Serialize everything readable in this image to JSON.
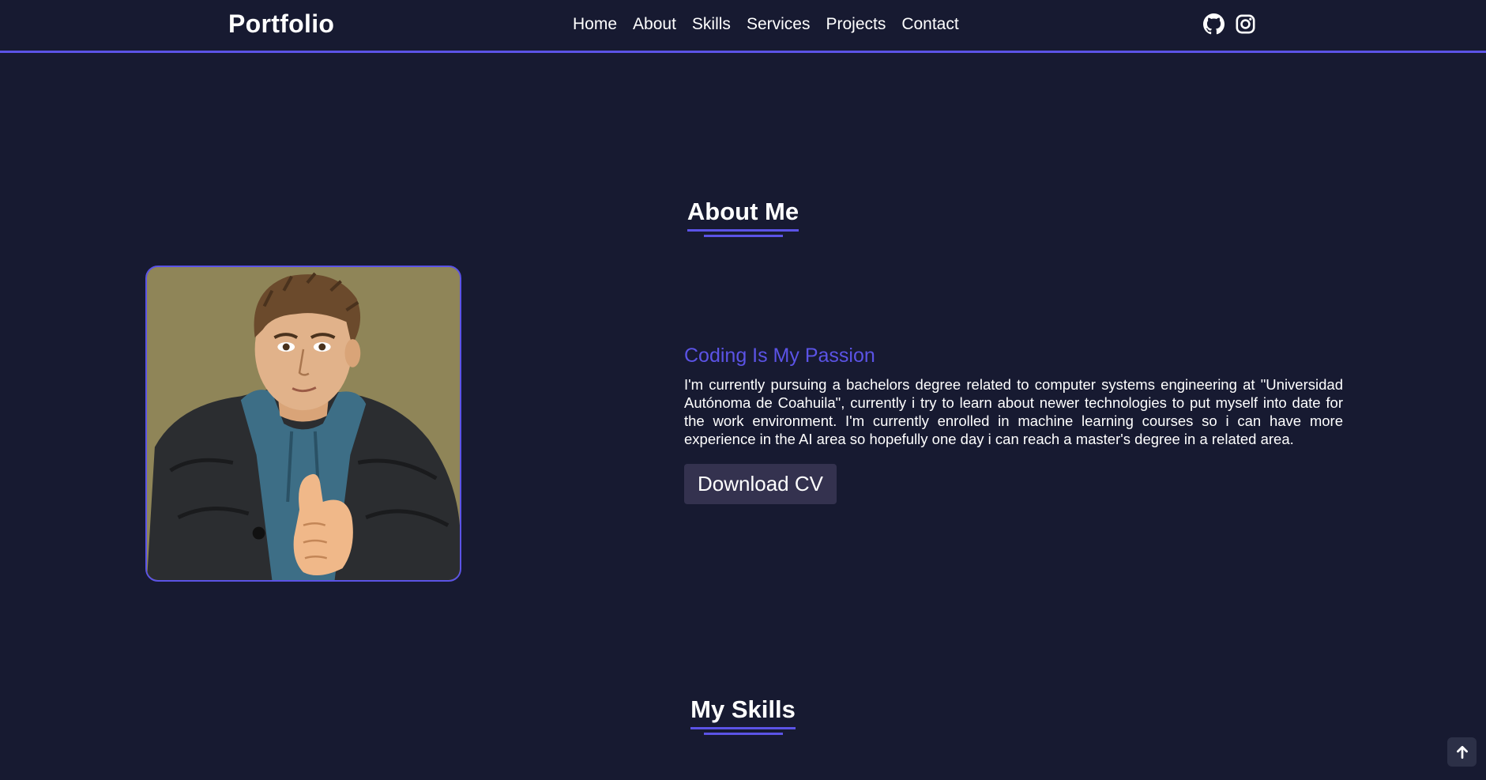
{
  "header": {
    "logo": "Portfolio",
    "nav": [
      "Home",
      "About",
      "Skills",
      "Services",
      "Projects",
      "Contact"
    ],
    "socials": [
      {
        "icon": "github-icon"
      },
      {
        "icon": "instagram-icon"
      }
    ]
  },
  "about": {
    "title": "About Me",
    "subtitle": "Coding Is My Passion",
    "paragraph": "I'm currently pursuing a bachelors degree related to computer systems engineering at \"Universidad Autónoma de Coahuila\", currently i try to learn about newer technologies to put myself into date for the work environment. I'm currently enrolled in machine learning courses so i can have more experience in the AI area so hopefully one day i can reach a master's degree in a related area.",
    "button": "Download CV"
  },
  "skills": {
    "title": "My Skills"
  },
  "back_to_top": {
    "icon": "arrow-up-icon"
  },
  "colors": {
    "background": "#171a31",
    "accent": "#5b53e6",
    "button": "#34324f"
  }
}
